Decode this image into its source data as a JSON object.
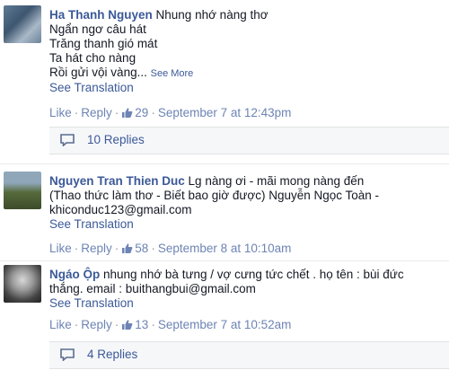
{
  "comments": [
    {
      "author": "Ha Thanh Nguyen",
      "lines": [
        "Nhung nhớ nàng thơ",
        "Ngẩn ngơ câu hát",
        "Trăng thanh gió mát",
        "Ta hát cho nàng",
        "Rồi gửi vội vàng..."
      ],
      "see_more": "See More",
      "see_translation": "See Translation",
      "like": "Like",
      "reply": "Reply",
      "like_count": "29",
      "timestamp": "September 7 at 12:43pm",
      "replies": "10 Replies"
    },
    {
      "author": "Nguyen Tran Thien Duc",
      "lines": [
        "Lg nàng ơi - mãi mong nàng đến",
        "(Thao thức làm thơ - Biết bao giờ được) Nguyễn Ngọc Toàn -",
        "khiconduc123@gmail.com"
      ],
      "see_translation": "See Translation",
      "like": "Like",
      "reply": "Reply",
      "like_count": "58",
      "timestamp": "September 8 at 10:10am"
    },
    {
      "author": "Ngáo Ộp",
      "lines": [
        "nhung nhớ bà tưng / vợ cưng tức chết . họ tên : bùi đức",
        "thắng. email : buithangbui@gmail.com"
      ],
      "see_translation": "See Translation",
      "like": "Like",
      "reply": "Reply",
      "like_count": "13",
      "timestamp": "September 7 at 10:52am",
      "replies": "4 Replies"
    }
  ],
  "colors": {
    "link": "#3b5998",
    "meta": "#6d84b4",
    "reply_bg": "#f6f7f9"
  },
  "icons": [
    "like-thumb-icon",
    "reply-bubble-icon"
  ]
}
